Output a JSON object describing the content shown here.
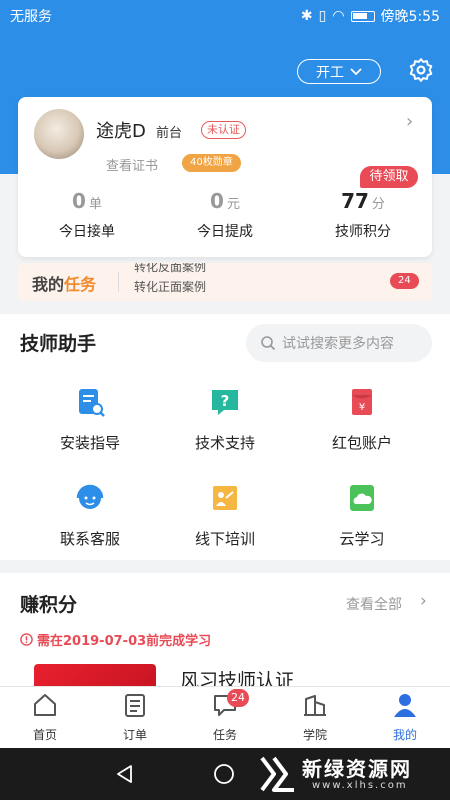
{
  "status_bar": {
    "carrier": "无服务",
    "time": "傍晚5:55"
  },
  "header": {
    "work_button": "开工"
  },
  "profile": {
    "name": "途虎D",
    "role": "前台",
    "verify_status": "未认证",
    "view_cert": "查看证书",
    "badge_count": "40枚勋章",
    "pending_label": "待领取",
    "stats": [
      {
        "value": "0",
        "unit": "单",
        "label": "今日接单"
      },
      {
        "value": "0",
        "unit": "元",
        "label": "今日提成"
      },
      {
        "value": "77",
        "unit": "分",
        "label": "技师积分"
      }
    ]
  },
  "my_tasks": {
    "title_a": "我的",
    "title_b": "任务",
    "line1": "转化反面案例",
    "line2": "转化正面案例",
    "count": "24"
  },
  "assistant": {
    "title": "技师助手",
    "search_placeholder": "试试搜索更多内容",
    "tools": [
      {
        "label": "安装指导",
        "icon": "install-guide-icon"
      },
      {
        "label": "技术支持",
        "icon": "tech-support-icon"
      },
      {
        "label": "红包账户",
        "icon": "red-envelope-icon"
      },
      {
        "label": "联系客服",
        "icon": "customer-service-icon"
      },
      {
        "label": "线下培训",
        "icon": "offline-training-icon"
      },
      {
        "label": "云学习",
        "icon": "cloud-learning-icon"
      }
    ]
  },
  "earn_points": {
    "title": "赚积分",
    "view_all": "查看全部",
    "deadline": "需在2019-07-03前完成学习",
    "course_title": "风习技师认证"
  },
  "bottom_nav": [
    {
      "label": "首页",
      "icon": "home-icon"
    },
    {
      "label": "订单",
      "icon": "orders-icon"
    },
    {
      "label": "任务",
      "icon": "tasks-icon",
      "badge": "24"
    },
    {
      "label": "学院",
      "icon": "academy-icon"
    },
    {
      "label": "我的",
      "icon": "profile-icon",
      "active": true
    }
  ],
  "watermark": {
    "name": "新绿资源网",
    "url": "www.xlhs.com"
  },
  "colors": {
    "primary": "#2d8ee8",
    "accent_red": "#e84b55",
    "orange": "#f08a2b",
    "active_nav": "#2d6fe0"
  }
}
